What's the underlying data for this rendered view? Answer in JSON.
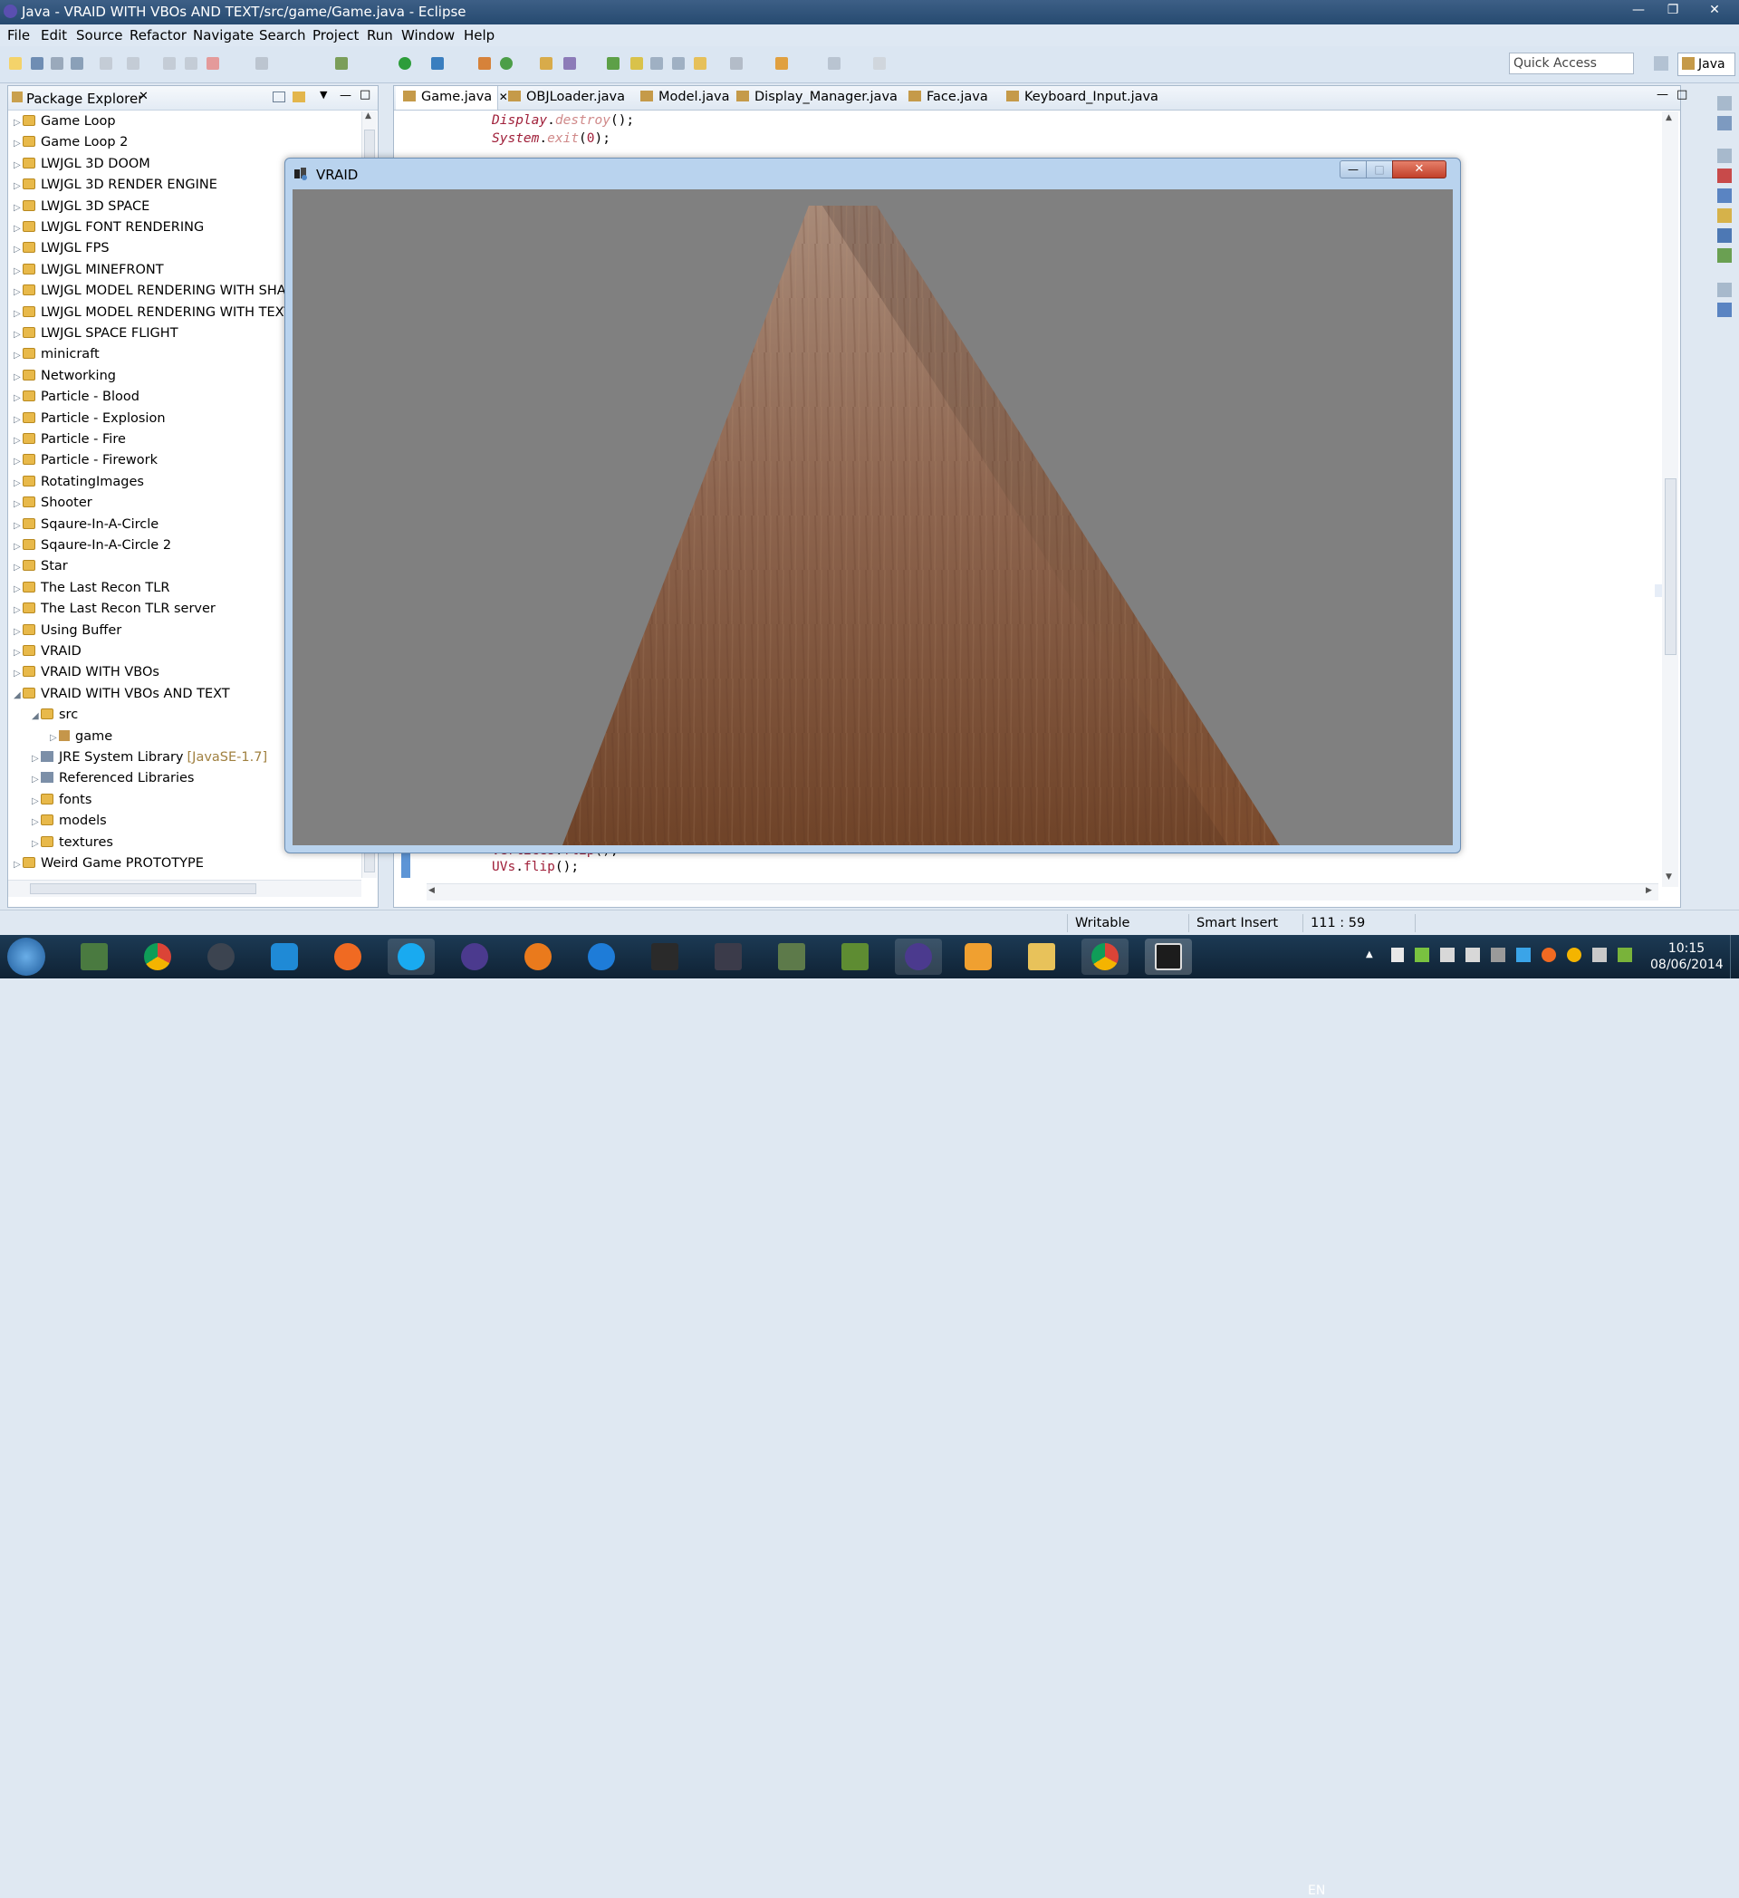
{
  "window": {
    "title": "Java - VRAID WITH VBOs AND TEXT/src/game/Game.java - Eclipse"
  },
  "menu": [
    "File",
    "Edit",
    "Source",
    "Refactor",
    "Navigate",
    "Search",
    "Project",
    "Run",
    "Window",
    "Help"
  ],
  "toolbar": {
    "quick_access": "Quick Access",
    "perspective": "Java"
  },
  "package_explorer": {
    "title": "Package Explorer",
    "items": [
      {
        "label": "Game Loop",
        "depth": 0,
        "icon": "project",
        "expanded": false
      },
      {
        "label": "Game Loop 2",
        "depth": 0,
        "icon": "project",
        "expanded": false
      },
      {
        "label": "LWJGL 3D DOOM",
        "depth": 0,
        "icon": "project",
        "expanded": false
      },
      {
        "label": "LWJGL 3D RENDER ENGINE",
        "depth": 0,
        "icon": "project",
        "expanded": false
      },
      {
        "label": "LWJGL 3D SPACE",
        "depth": 0,
        "icon": "project",
        "expanded": false
      },
      {
        "label": "LWJGL FONT RENDERING",
        "depth": 0,
        "icon": "project",
        "expanded": false
      },
      {
        "label": "LWJGL FPS",
        "depth": 0,
        "icon": "project",
        "expanded": false
      },
      {
        "label": "LWJGL MINEFRONT",
        "depth": 0,
        "icon": "project",
        "expanded": false
      },
      {
        "label": "LWJGL MODEL RENDERING WITH SHAI",
        "depth": 0,
        "icon": "project",
        "expanded": false
      },
      {
        "label": "LWJGL MODEL RENDERING WITH TEXT",
        "depth": 0,
        "icon": "project",
        "expanded": false
      },
      {
        "label": "LWJGL SPACE FLIGHT",
        "depth": 0,
        "icon": "project",
        "expanded": false
      },
      {
        "label": "minicraft",
        "depth": 0,
        "icon": "project",
        "expanded": false
      },
      {
        "label": "Networking",
        "depth": 0,
        "icon": "project",
        "expanded": false
      },
      {
        "label": "Particle - Blood",
        "depth": 0,
        "icon": "project",
        "expanded": false
      },
      {
        "label": "Particle - Explosion",
        "depth": 0,
        "icon": "project",
        "expanded": false
      },
      {
        "label": "Particle - Fire",
        "depth": 0,
        "icon": "project",
        "expanded": false
      },
      {
        "label": "Particle - Firework",
        "depth": 0,
        "icon": "project",
        "expanded": false
      },
      {
        "label": "RotatingImages",
        "depth": 0,
        "icon": "project",
        "expanded": false
      },
      {
        "label": "Shooter",
        "depth": 0,
        "icon": "project",
        "expanded": false
      },
      {
        "label": "Sqaure-In-A-Circle",
        "depth": 0,
        "icon": "project",
        "expanded": false
      },
      {
        "label": "Sqaure-In-A-Circle 2",
        "depth": 0,
        "icon": "project",
        "expanded": false
      },
      {
        "label": "Star",
        "depth": 0,
        "icon": "project",
        "expanded": false
      },
      {
        "label": "The Last Recon TLR",
        "depth": 0,
        "icon": "project",
        "expanded": false
      },
      {
        "label": "The Last Recon TLR server",
        "depth": 0,
        "icon": "project",
        "expanded": false
      },
      {
        "label": "Using Buffer",
        "depth": 0,
        "icon": "project",
        "expanded": false
      },
      {
        "label": "VRAID",
        "depth": 0,
        "icon": "project",
        "expanded": false
      },
      {
        "label": "VRAID WITH VBOs",
        "depth": 0,
        "icon": "project",
        "expanded": false
      },
      {
        "label": "VRAID WITH VBOs AND TEXT",
        "depth": 0,
        "icon": "project",
        "expanded": true
      },
      {
        "label": "src",
        "depth": 1,
        "icon": "source-folder",
        "expanded": true
      },
      {
        "label": "game",
        "depth": 2,
        "icon": "package",
        "expanded": false
      },
      {
        "label": "JRE System Library",
        "suffix": "[JavaSE-1.7]",
        "depth": 1,
        "icon": "library",
        "expanded": false
      },
      {
        "label": "Referenced Libraries",
        "depth": 1,
        "icon": "library",
        "expanded": false
      },
      {
        "label": "fonts",
        "depth": 1,
        "icon": "folder",
        "expanded": false
      },
      {
        "label": "models",
        "depth": 1,
        "icon": "folder",
        "expanded": false
      },
      {
        "label": "textures",
        "depth": 1,
        "icon": "folder",
        "expanded": false
      },
      {
        "label": "Weird Game PROTOTYPE",
        "depth": 0,
        "icon": "project",
        "expanded": false
      }
    ]
  },
  "editor": {
    "tabs": [
      "Game.java",
      "OBJLoader.java",
      "Model.java",
      "Display_Manager.java",
      "Face.java",
      "Keyboard_Input.java"
    ],
    "active_tab": "Game.java",
    "code_top": [
      {
        "obj": "Display",
        "method": "destroy",
        "args": ""
      },
      {
        "obj": "System",
        "method": "exit",
        "args": "0"
      }
    ],
    "code_bottom": [
      {
        "obj": "vertices",
        "method": "flip",
        "args": ""
      },
      {
        "obj": "UVs",
        "method": "flip",
        "args": ""
      }
    ]
  },
  "vraid_window": {
    "title": "VRAID"
  },
  "status": {
    "writable": "Writable",
    "insert_mode": "Smart Insert",
    "position": "111 : 59"
  },
  "taskbar": {
    "apps": [
      "start",
      "eclipse-workspace",
      "chrome",
      "steam",
      "uplay",
      "origin",
      "skype",
      "eclipse",
      "blender",
      "battlenet",
      "arma",
      "game-hitman",
      "sc",
      "minecraft",
      "eclipse-2",
      "media-player",
      "explorer",
      "chrome-2",
      "vraid"
    ],
    "language": "EN",
    "time": "10:15",
    "date": "08/06/2014"
  },
  "colors": {
    "accent": "#264a70",
    "viewport_bg": "#808080",
    "wood": "#8b5a3a"
  }
}
